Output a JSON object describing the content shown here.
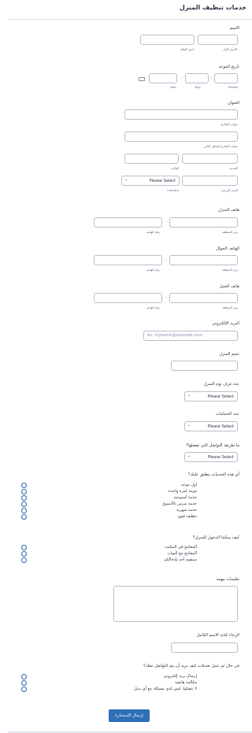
{
  "header": {
    "title": "خدمات تنظيف المنزل"
  },
  "name": {
    "label": "الاسم",
    "first_sub": "الاسم الأول",
    "last_sub": "اسم العائلة"
  },
  "appointment": {
    "label": "تاريخ الموعد",
    "month": "Month",
    "day": "Day",
    "year": "Year"
  },
  "address": {
    "label": "العنوان",
    "street1_sub": "عنوان الشارع",
    "street2_sub": "عنوان الشارع السطر الثاني",
    "city_sub": "المدينة",
    "state_sub": "الولاية",
    "zip_sub": "الرمز البريدي",
    "country_sub": "Country",
    "country_value": "Please Select"
  },
  "home_phone": {
    "label": "هاتف المنزل",
    "area_sub": "رمز المنطقة",
    "number_sub": "رقم الهاتف"
  },
  "mobile_phone": {
    "label": "الهاتف الجوال",
    "area_sub": "رمز المنطقة",
    "number_sub": "رقم الهاتف"
  },
  "work_phone": {
    "label": "هاتف العمل",
    "area_sub": "رمز المنطقة",
    "number_sub": "رقم الهاتف"
  },
  "email": {
    "label": "البريد الإلكتروني",
    "placeholder": "ex: myname@example.com"
  },
  "home_size": {
    "label": "حجم المنزل"
  },
  "room_count": {
    "label": "عدد غرف نوم المنزل",
    "value": "Please Select"
  },
  "bath_count": {
    "label": "عدد الحمامات",
    "value": "Please Select"
  },
  "contact_method": {
    "label": "ما طريقة التواصل التي تفضلها؟",
    "value": "Please Select"
  },
  "services": {
    "label": "أي هذه الخدمات ينطبق عليك؟",
    "options": [
      "أول موعد",
      "موعد لمرة واحدة",
      "خدمة أسبوعية",
      "خدمة مرتين بالأسبوع",
      "خدمة شهرية",
      "تنظيف قوي"
    ]
  },
  "access": {
    "label": "كيف يمكننا الدخول للمنزل؟",
    "options": [
      "المفاتيح في المكتب",
      "المفاتيح مع البواب",
      "سيقوم أحد بإدخالكم"
    ]
  },
  "instructions": {
    "label": "تعليمات مهمة"
  },
  "full_name": {
    "label": "الرجاء كتابة الاسم الكامل"
  },
  "change_contact": {
    "label": "في حال تم عمل تعديلات كيف تريد أن يتم التواصل معك؟",
    "options": [
      "إرسال بريد إلكتروني",
      "مكالمة هاتفية",
      "لا تتصلوا، ليس لدي مشكلة مع أي بديل"
    ]
  },
  "submit": {
    "label": "إرسال الإستمارة"
  }
}
